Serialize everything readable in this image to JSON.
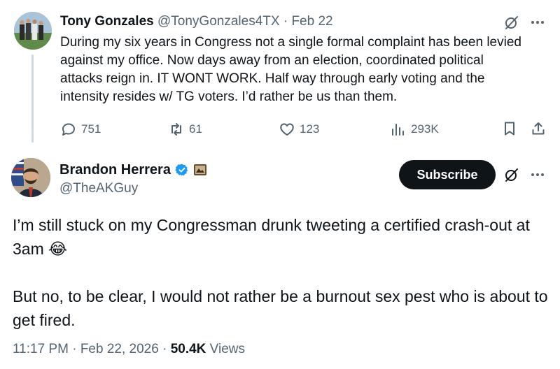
{
  "parent_tweet": {
    "author_name": "Tony Gonzales",
    "handle": "@TonyGonzales4TX",
    "separator": "·",
    "date": "Feb 22",
    "text": "During my six years in Congress not a single formal complaint has been levied against my office. Now days away from an election, coordinated political attacks reign in. IT WONT WORK. Half way through early voting and the intensity resides w/ TG voters. I’d rather be us than them.",
    "actions": {
      "replies": "751",
      "reposts": "61",
      "likes": "123",
      "views": "293K"
    },
    "icons": [
      "grok-icon",
      "more-icon",
      "reply-icon",
      "repost-icon",
      "like-icon",
      "views-icon",
      "bookmark-icon",
      "share-icon"
    ]
  },
  "main_tweet": {
    "author_name": "Brandon Herrera",
    "handle": "@TheAKGuy",
    "verified": true,
    "subscribe_label": "Subscribe",
    "paragraph_1": "I’m still stuck on my Congressman drunk tweeting a certified crash-out at 3am 😂",
    "paragraph_2": "But no, to be clear, I would not rather be a burnout sex pest who is about to get fired.",
    "time": "11:17 PM",
    "dot": "·",
    "date": "Feb 22, 2026",
    "view_count": "50.4K",
    "views_label": "Views"
  },
  "colors": {
    "text_primary": "#0f1419",
    "text_secondary": "#536471",
    "verified_blue": "#1d9bf0",
    "thread_line": "#cfd9de",
    "subscribe_bg": "#0f1419"
  }
}
